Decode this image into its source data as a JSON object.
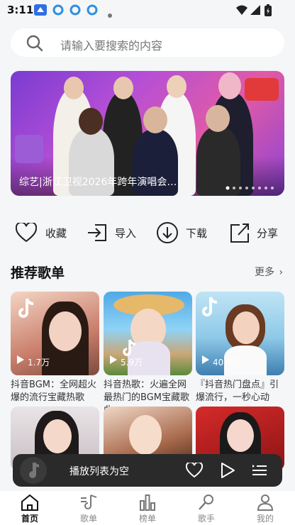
{
  "status_bar": {
    "time": "3:11"
  },
  "search": {
    "placeholder": "请输入要搜索的内容"
  },
  "banner": {
    "caption": "综艺|浙江卫视2026年跨年演唱会…"
  },
  "actions": [
    {
      "label": "收藏",
      "icon": "heart-icon"
    },
    {
      "label": "导入",
      "icon": "import-icon"
    },
    {
      "label": "下载",
      "icon": "download-icon"
    },
    {
      "label": "分享",
      "icon": "share-icon"
    }
  ],
  "section": {
    "title": "推荐歌单",
    "more": "更多"
  },
  "playlists": [
    {
      "count": "1.7万",
      "title": "抖音BGM：全网超火爆的流行宝藏热歌"
    },
    {
      "count": "5.9万",
      "title": "抖音热歌：火遍全网最热门的BGM宝藏歌曲"
    },
    {
      "count": "40.4万",
      "title": "『抖音热门盘点』引爆流行，一秒心动"
    }
  ],
  "player": {
    "status": "播放列表为空"
  },
  "nav": [
    {
      "label": "首页",
      "icon": "home-icon"
    },
    {
      "label": "歌单",
      "icon": "music-note-icon"
    },
    {
      "label": "榜单",
      "icon": "bar-chart-icon"
    },
    {
      "label": "歌手",
      "icon": "microphone-icon"
    },
    {
      "label": "我的",
      "icon": "user-icon"
    }
  ],
  "colors": {
    "background": "#f4f6f8",
    "player_bg": "#2a2a2a",
    "accent": "#111111"
  }
}
